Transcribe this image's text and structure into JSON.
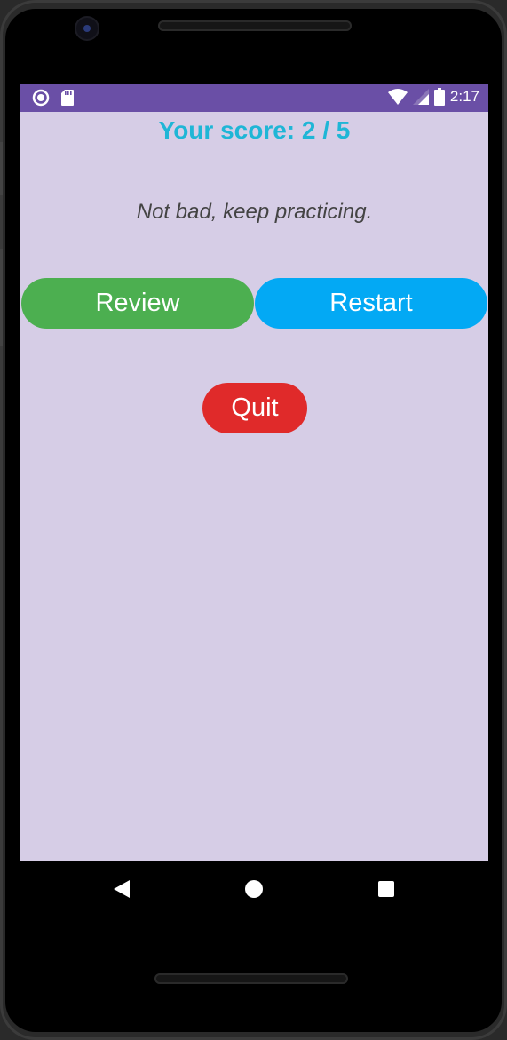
{
  "status_bar": {
    "time": "2:17",
    "left_icons": [
      "circle-notification-icon",
      "sd-card-icon"
    ],
    "right_icons": [
      "wifi-icon",
      "signal-icon",
      "battery-icon"
    ],
    "color": "#6a4fa6"
  },
  "score": {
    "text": "Your score: 2 / 5",
    "color": "#1fb6d6"
  },
  "feedback": {
    "text": "Not bad, keep practicing."
  },
  "buttons": {
    "review_label": "Review",
    "restart_label": "Restart",
    "quit_label": "Quit",
    "review_color": "#4caf50",
    "restart_color": "#03a9f4",
    "quit_color": "#e02a2a"
  },
  "navigation": {
    "icons": [
      "back-icon",
      "home-icon",
      "recent-apps-icon"
    ]
  },
  "screen_background": "#d6cde6"
}
